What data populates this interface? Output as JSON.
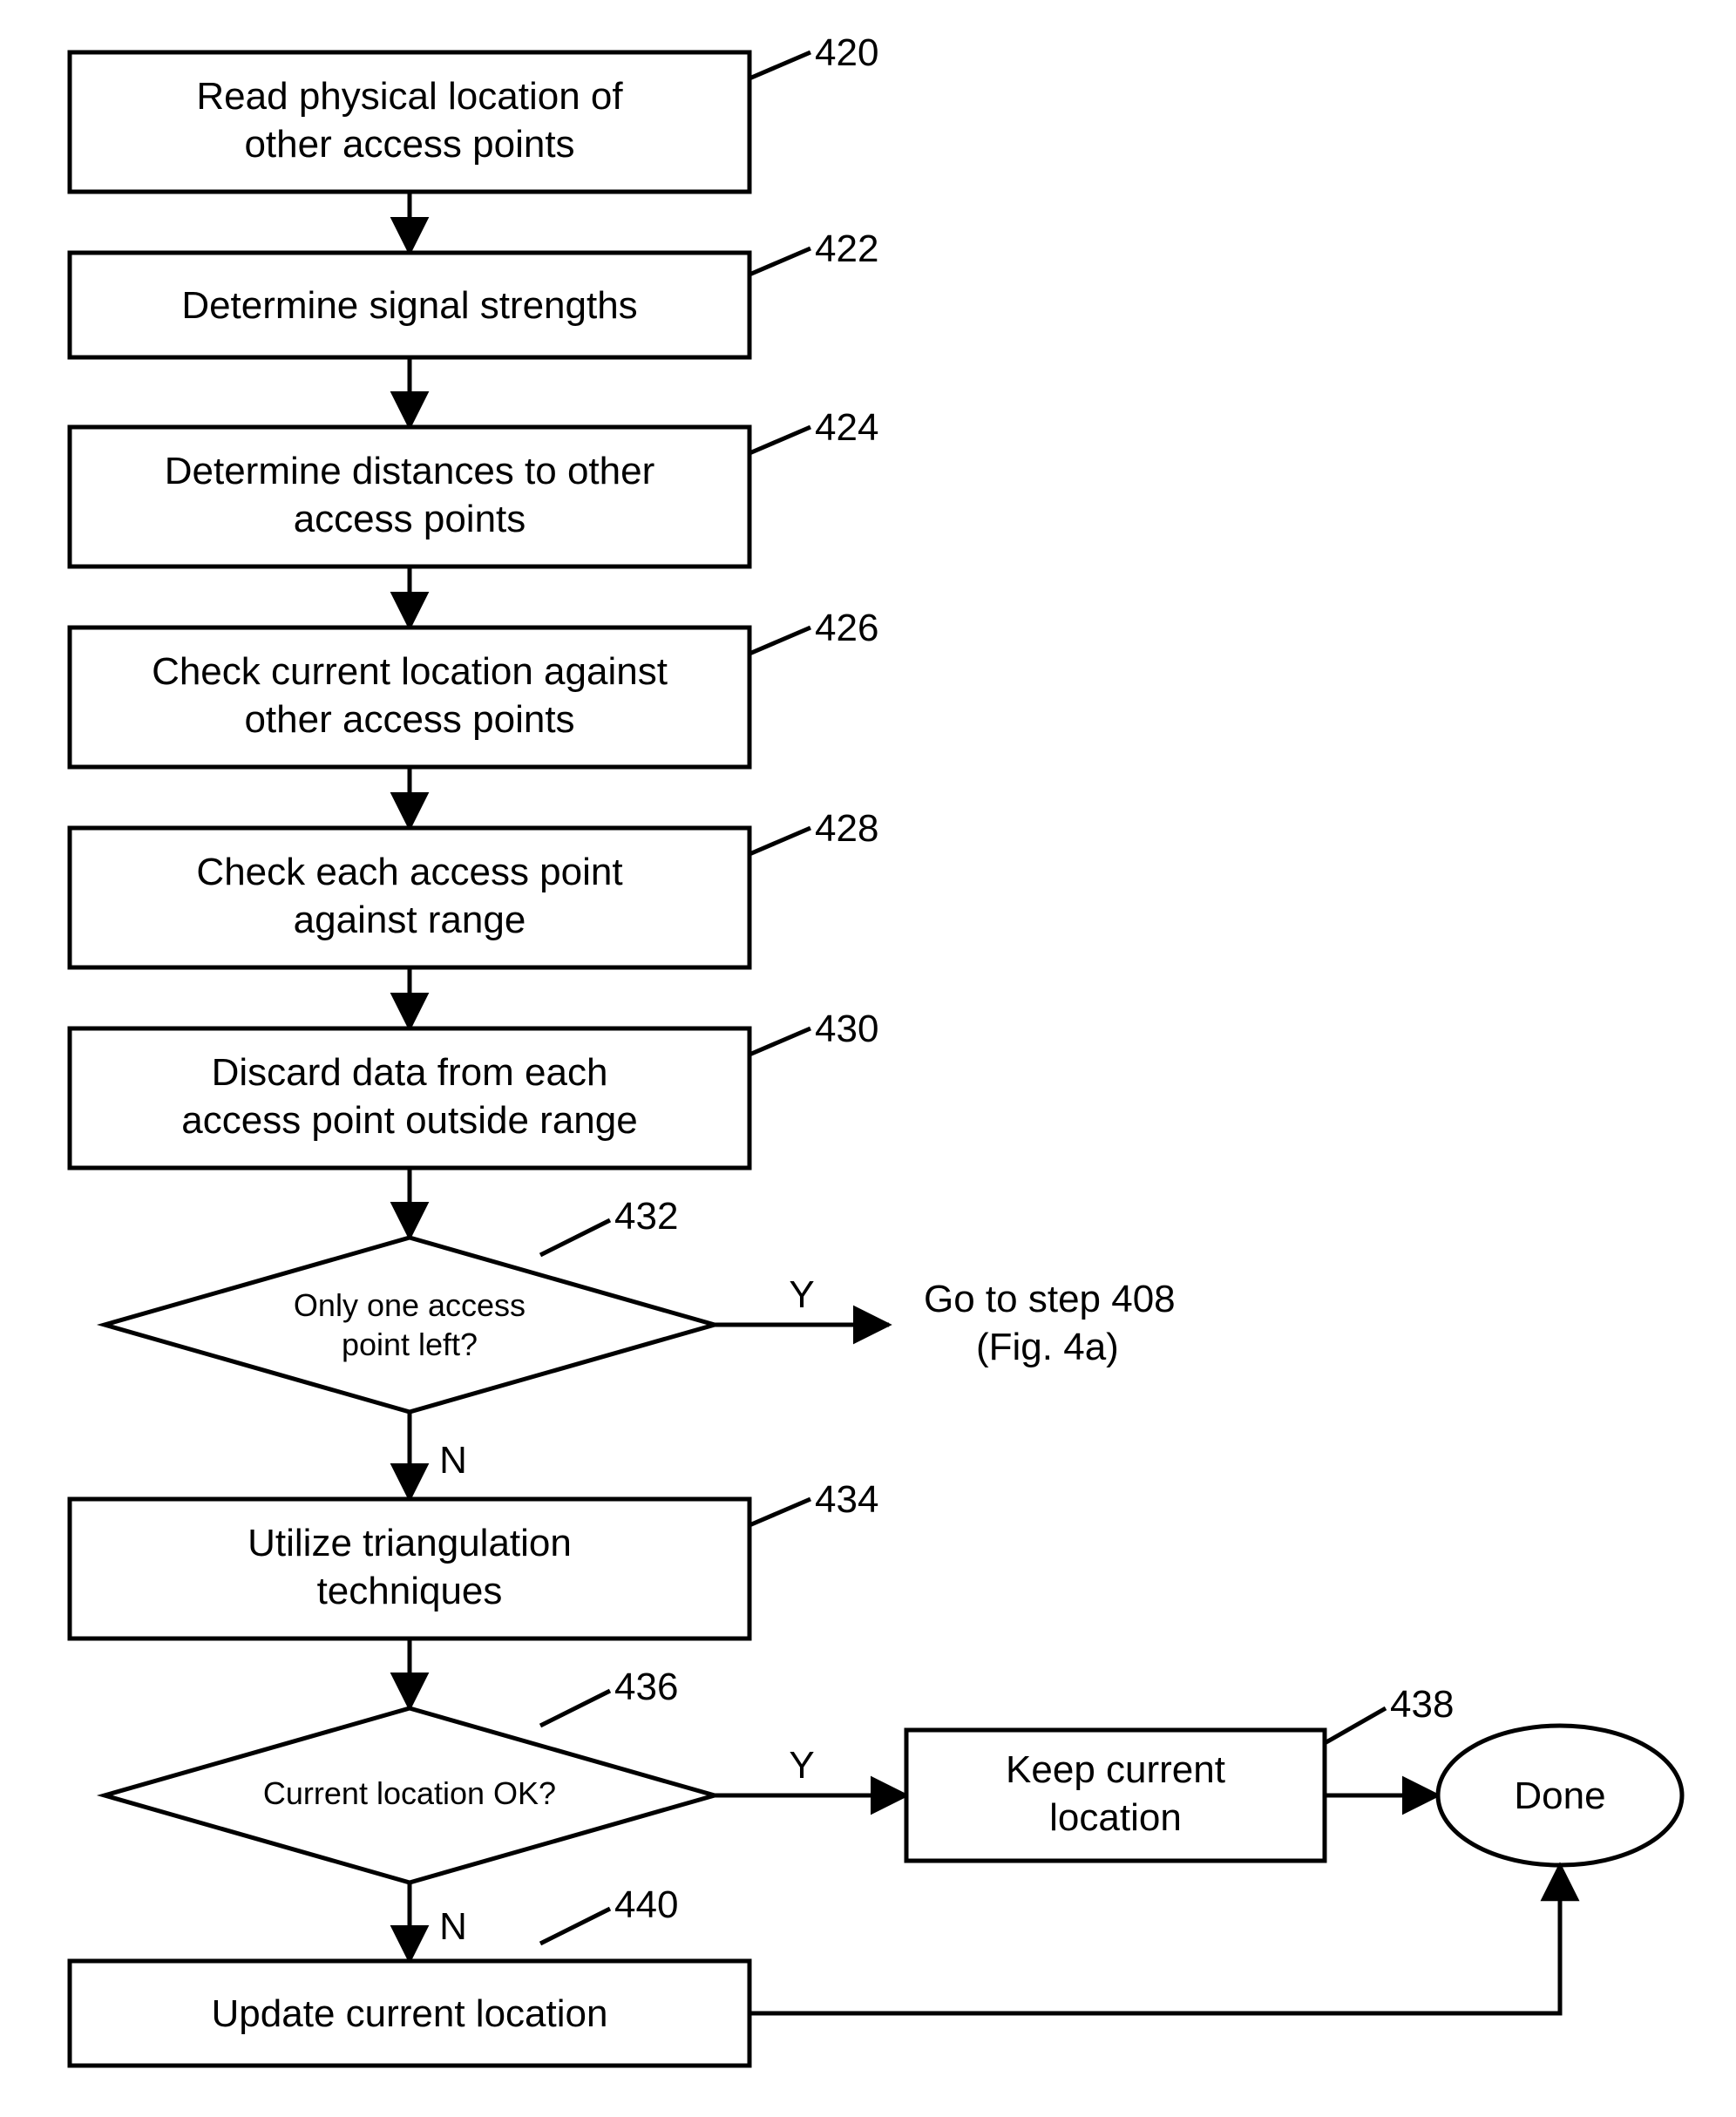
{
  "nodes": {
    "n420": {
      "ref": "420",
      "lines": [
        "Read physical location of",
        "other access points"
      ]
    },
    "n422": {
      "ref": "422",
      "lines": [
        "Determine signal strengths"
      ]
    },
    "n424": {
      "ref": "424",
      "lines": [
        "Determine distances to other",
        "access points"
      ]
    },
    "n426": {
      "ref": "426",
      "lines": [
        "Check current location against",
        "other access points"
      ]
    },
    "n428": {
      "ref": "428",
      "lines": [
        "Check each access point",
        "against range"
      ]
    },
    "n430": {
      "ref": "430",
      "lines": [
        "Discard data from each",
        "access point outside range"
      ]
    },
    "n432": {
      "ref": "432",
      "lines": [
        "Only one access",
        "point left?"
      ]
    },
    "n434": {
      "ref": "434",
      "lines": [
        "Utilize triangulation",
        "techniques"
      ]
    },
    "n436": {
      "ref": "436",
      "lines": [
        "Current location OK?"
      ]
    },
    "n438": {
      "ref": "438",
      "lines": [
        "Keep current",
        "location"
      ]
    },
    "n440": {
      "ref": "440",
      "lines": [
        "Update current location"
      ]
    },
    "done": {
      "lines": [
        "Done"
      ]
    },
    "goto": {
      "lines": [
        "Go to step 408",
        "(Fig. 4a)"
      ]
    }
  },
  "labels": {
    "Y": "Y",
    "N": "N"
  }
}
